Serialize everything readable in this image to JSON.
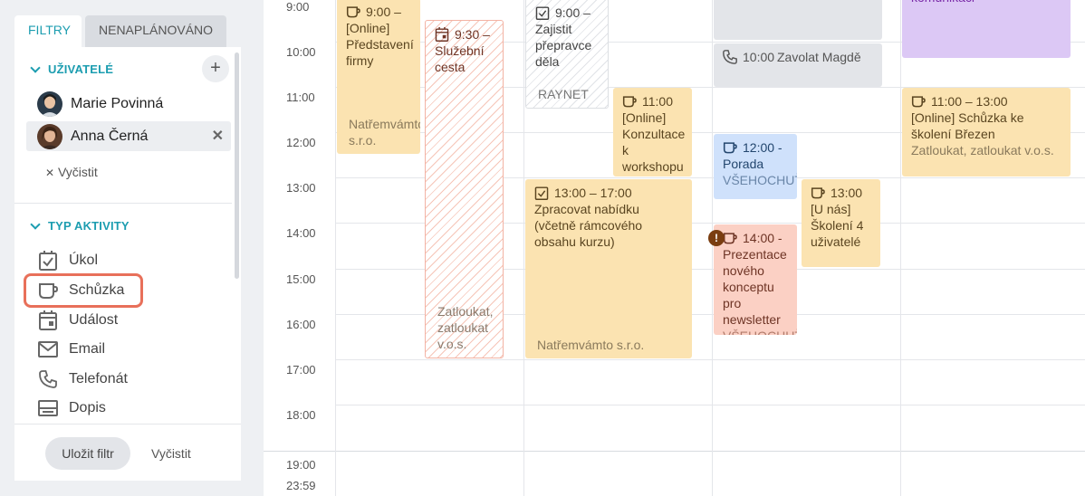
{
  "tabs": {
    "filters": "FILTRY",
    "unscheduled": "NENAPLÁNOVÁNO"
  },
  "users_section": {
    "title": "UŽIVATELÉ",
    "add_icon": "plus-icon",
    "users": [
      {
        "name": "Marie Povinná",
        "selected": false
      },
      {
        "name": "Anna Černá",
        "selected": true
      }
    ],
    "clear_label": "Vyčistit"
  },
  "activity_section": {
    "title": "TYP AKTIVITY",
    "types": [
      {
        "label": "Úkol",
        "icon": "task-check-icon"
      },
      {
        "label": "Schůzka",
        "icon": "meeting-cup-icon",
        "highlighted": true
      },
      {
        "label": "Událost",
        "icon": "event-calendar-icon"
      },
      {
        "label": "Email",
        "icon": "email-envelope-icon"
      },
      {
        "label": "Telefonát",
        "icon": "phone-icon"
      },
      {
        "label": "Dopis",
        "icon": "letter-icon"
      }
    ]
  },
  "footer": {
    "save_label": "Uložit filtr",
    "clear_label": "Vyčistit"
  },
  "calendar": {
    "hours": [
      "9:00",
      "10:00",
      "11:00",
      "12:00",
      "13:00",
      "14:00",
      "15:00",
      "16:00",
      "17:00",
      "18:00"
    ],
    "late_hours": [
      "19:00",
      "23:59"
    ],
    "events": [
      {
        "time": "9:00 –",
        "title": "[Online] Představení firmy",
        "company": "Natřemvámto s.r.o."
      },
      {
        "time": "9:30 –",
        "title": "Služební cesta",
        "company": "Zatloukat, zatloukat v.o.s."
      },
      {
        "time": "9:00 –",
        "title": "Zajistit přepravce děla",
        "company": "RAYNET"
      },
      {
        "time": "11:00",
        "title": "[Online] Konzultace k workshopu"
      },
      {
        "time": "13:00 – 17:00",
        "title": "Zpracovat nabídku (včetně rámcového obsahu kurzu)",
        "company": "Natřemvámto s.r.o."
      },
      {
        "time": "10:00",
        "title": "Zavolat Magdě"
      },
      {
        "time": "12:00 -",
        "title": "Porada",
        "company": "VŠEHOCHUŤ s.r.o."
      },
      {
        "time": "13:00",
        "title": "[U nás] Školení 4 uživatelé"
      },
      {
        "time": "14:00 -",
        "title": "Prezentace nového konceptu pro newsletter",
        "company": "VŠEHOCHUŤ"
      },
      {
        "title": "komunikaci"
      },
      {
        "time": "11:00 – 13:00",
        "title": "[Online] Schůzka ke školení Březen",
        "company": "Zatloukat, zatloukat v.o.s."
      }
    ],
    "warning_label": "!"
  },
  "colors": {
    "accent": "#1c9db0",
    "meeting": "#fbe3b1",
    "call": "#e3e5e9",
    "blue_meeting": "#cfe1fb",
    "salmon_meeting": "#fbd0c4",
    "purple_event": "#dcc8f5",
    "highlight": "#e8705a"
  }
}
